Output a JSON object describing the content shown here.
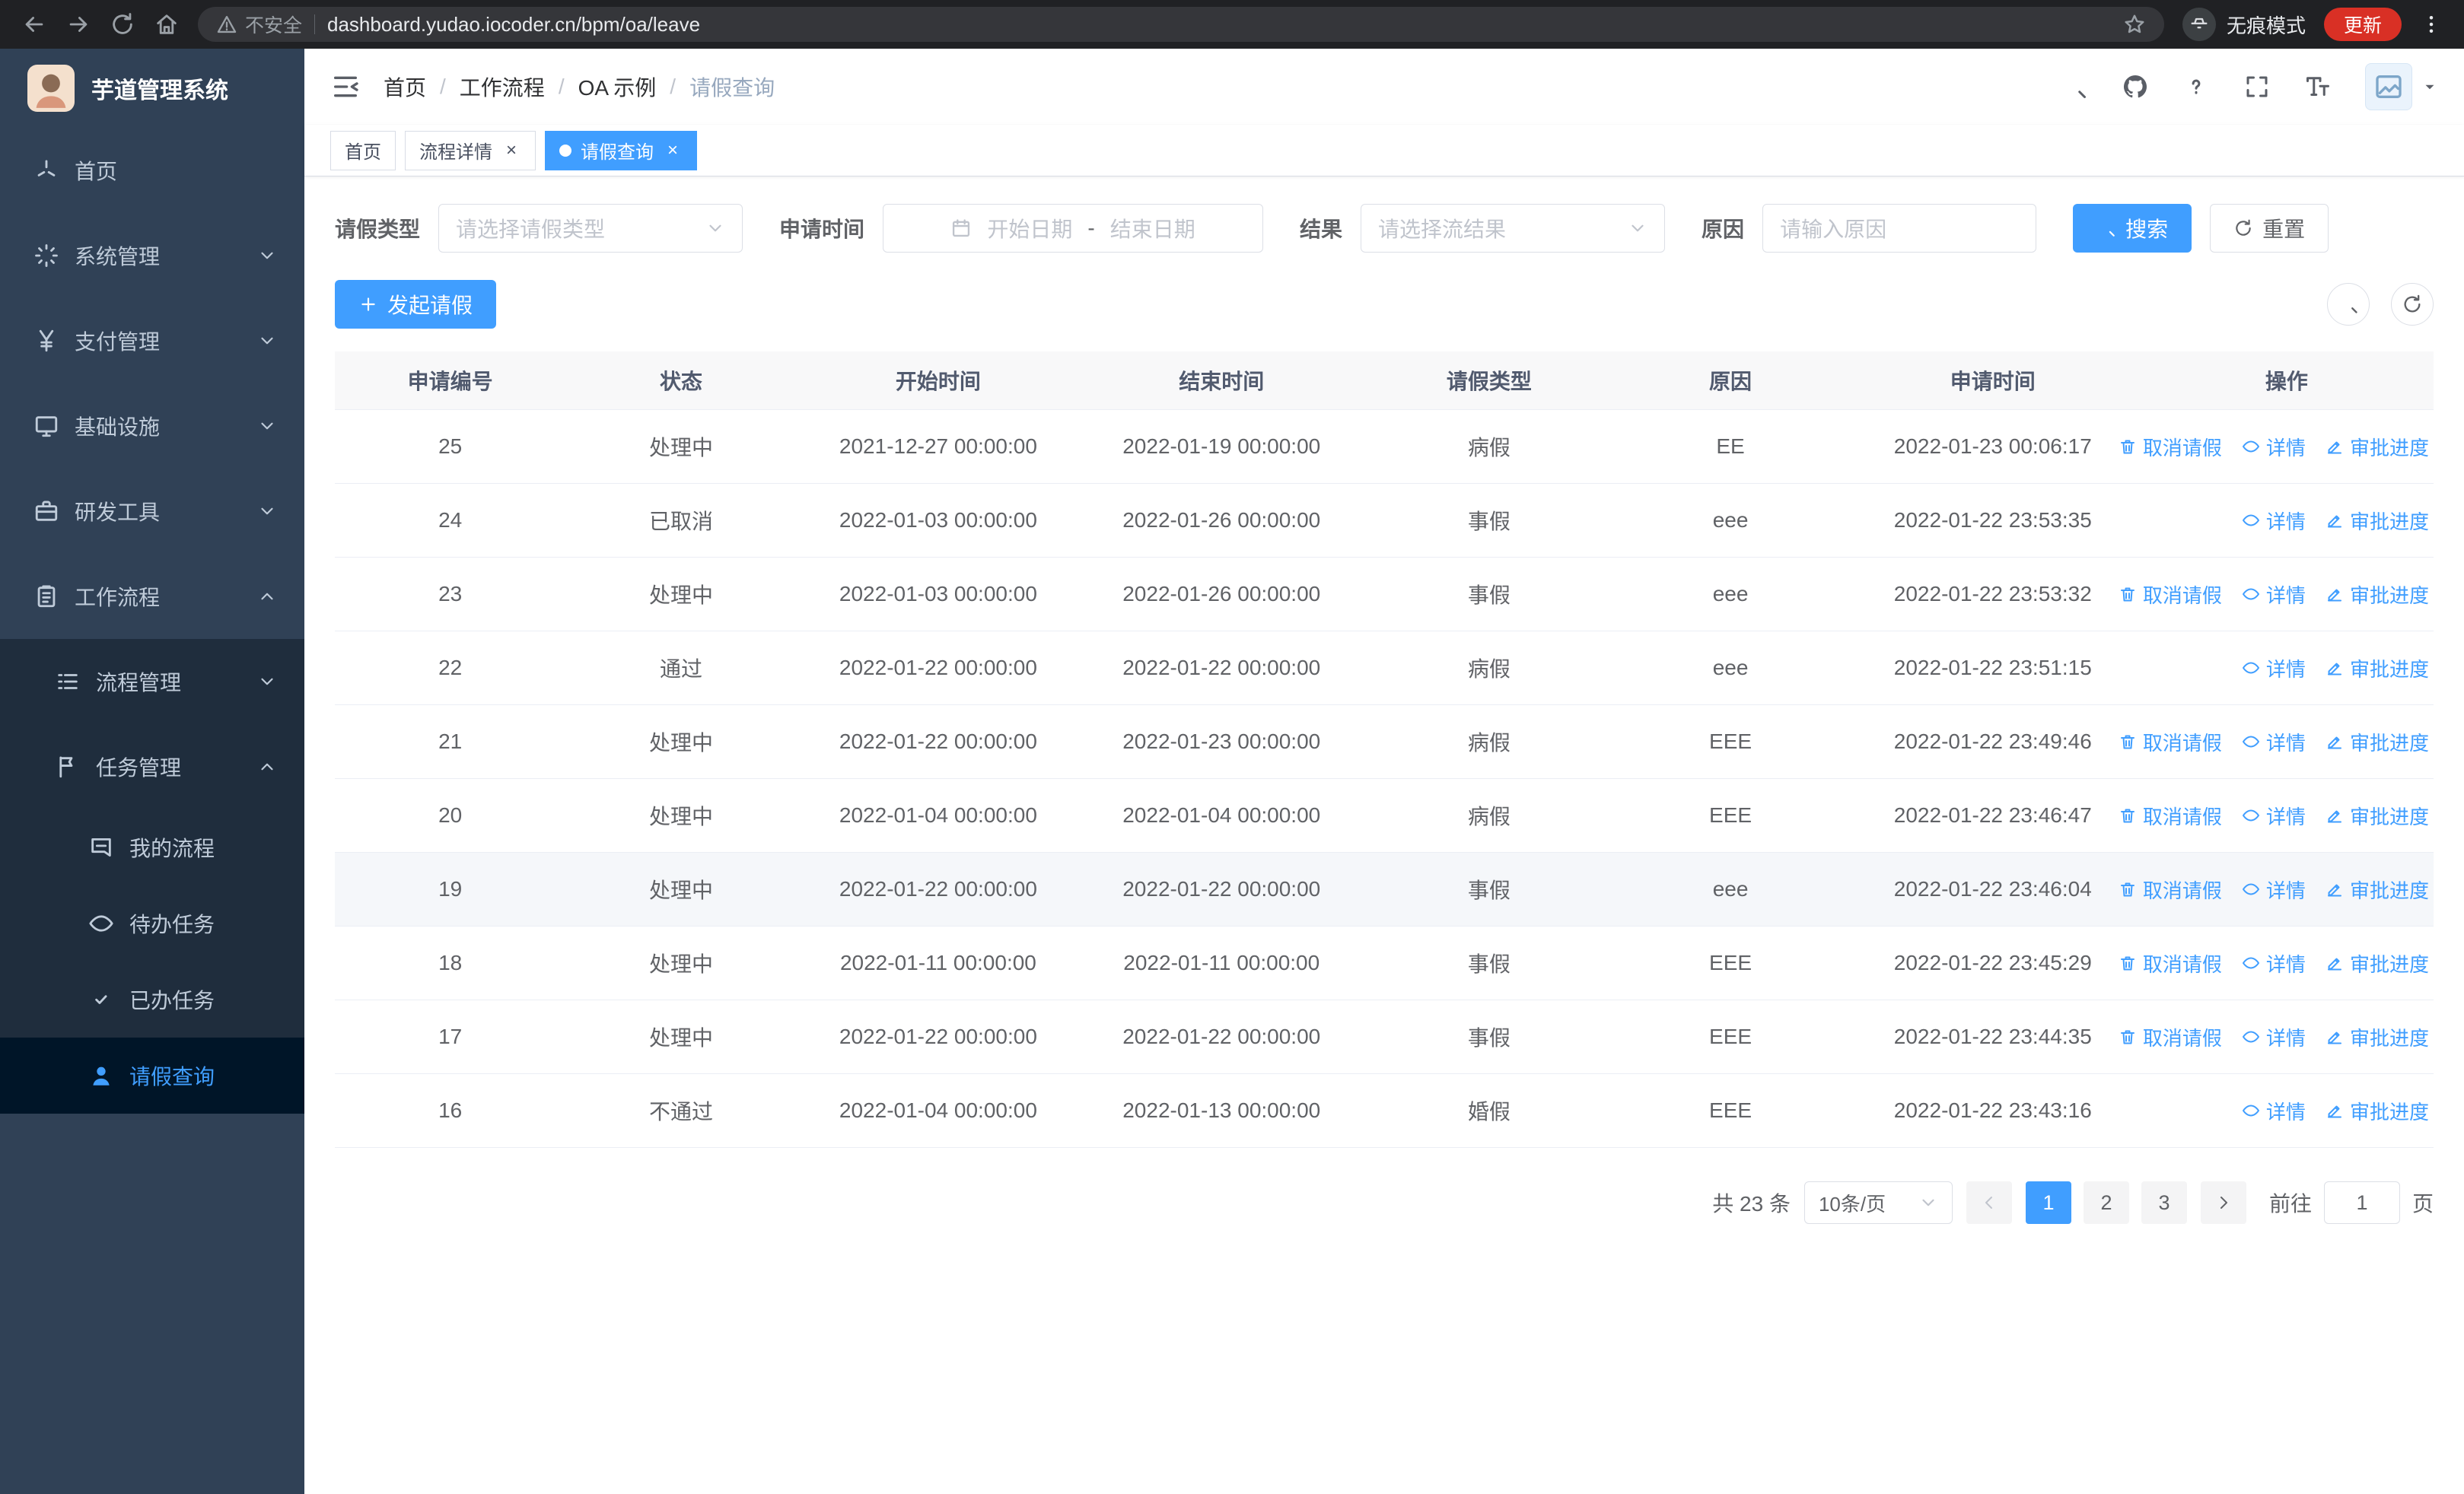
{
  "browser": {
    "security_label": "不安全",
    "url": "dashboard.yudao.iocoder.cn/bpm/oa/leave",
    "incognito_label": "无痕模式",
    "update_label": "更新"
  },
  "sidebar": {
    "logo_title": "芋道管理系统",
    "items": [
      {
        "key": "home",
        "label": "首页",
        "icon": "dashboard",
        "level": 1
      },
      {
        "key": "system",
        "label": "系统管理",
        "icon": "gear",
        "level": 1,
        "arrow": "down"
      },
      {
        "key": "payment",
        "label": "支付管理",
        "icon": "yen",
        "level": 1,
        "arrow": "down"
      },
      {
        "key": "infrastructure",
        "label": "基础设施",
        "icon": "monitor",
        "level": 1,
        "arrow": "down"
      },
      {
        "key": "devtools",
        "label": "研发工具",
        "icon": "briefcase",
        "level": 1,
        "arrow": "down"
      },
      {
        "key": "workflow",
        "label": "工作流程",
        "icon": "clipboard",
        "level": 1,
        "arrow": "up"
      },
      {
        "key": "process-mgmt",
        "label": "流程管理",
        "icon": "list",
        "level": 2,
        "arrow": "down"
      },
      {
        "key": "task-mgmt",
        "label": "任务管理",
        "icon": "flag",
        "level": 2,
        "arrow": "up"
      },
      {
        "key": "my-process",
        "label": "我的流程",
        "icon": "chat",
        "level": 3
      },
      {
        "key": "todo-task",
        "label": "待办任务",
        "icon": "eye",
        "level": 3
      },
      {
        "key": "done-task",
        "label": "已办任务",
        "icon": "check",
        "level": 3
      },
      {
        "key": "leave-query",
        "label": "请假查询",
        "icon": "user",
        "level": 3,
        "active": true
      }
    ]
  },
  "header": {
    "breadcrumb": [
      "首页",
      "工作流程",
      "OA 示例",
      "请假查询"
    ]
  },
  "tabs": [
    {
      "key": "home",
      "label": "首页",
      "closable": false,
      "active": false
    },
    {
      "key": "process-detail",
      "label": "流程详情",
      "closable": true,
      "active": false
    },
    {
      "key": "leave-query",
      "label": "请假查询",
      "closable": true,
      "active": true
    }
  ],
  "filters": {
    "leave_type": {
      "label": "请假类型",
      "placeholder": "请选择请假类型"
    },
    "apply_time": {
      "label": "申请时间",
      "start_placeholder": "开始日期",
      "separator": "-",
      "end_placeholder": "结束日期"
    },
    "result": {
      "label": "结果",
      "placeholder": "请选择流结果"
    },
    "reason": {
      "label": "原因",
      "placeholder": "请输入原因"
    },
    "search_label": "搜索",
    "reset_label": "重置"
  },
  "toolbar": {
    "create_label": "发起请假"
  },
  "table": {
    "columns": [
      "申请编号",
      "状态",
      "开始时间",
      "结束时间",
      "请假类型",
      "原因",
      "申请时间",
      "操作"
    ],
    "op_labels": {
      "cancel": "取消请假",
      "detail": "详情",
      "progress": "审批进度"
    },
    "rows": [
      {
        "id": "25",
        "status": "处理中",
        "start": "2021-12-27 00:00:00",
        "end": "2022-01-19 00:00:00",
        "type": "病假",
        "reason": "EE",
        "applied": "2022-01-23 00:06:17",
        "ops": [
          "cancel",
          "detail",
          "progress"
        ]
      },
      {
        "id": "24",
        "status": "已取消",
        "start": "2022-01-03 00:00:00",
        "end": "2022-01-26 00:00:00",
        "type": "事假",
        "reason": "eee",
        "applied": "2022-01-22 23:53:35",
        "ops": [
          "detail",
          "progress"
        ]
      },
      {
        "id": "23",
        "status": "处理中",
        "start": "2022-01-03 00:00:00",
        "end": "2022-01-26 00:00:00",
        "type": "事假",
        "reason": "eee",
        "applied": "2022-01-22 23:53:32",
        "ops": [
          "cancel",
          "detail",
          "progress"
        ]
      },
      {
        "id": "22",
        "status": "通过",
        "start": "2022-01-22 00:00:00",
        "end": "2022-01-22 00:00:00",
        "type": "病假",
        "reason": "eee",
        "applied": "2022-01-22 23:51:15",
        "ops": [
          "detail",
          "progress"
        ]
      },
      {
        "id": "21",
        "status": "处理中",
        "start": "2022-01-22 00:00:00",
        "end": "2022-01-23 00:00:00",
        "type": "病假",
        "reason": "EEE",
        "applied": "2022-01-22 23:49:46",
        "ops": [
          "cancel",
          "detail",
          "progress"
        ]
      },
      {
        "id": "20",
        "status": "处理中",
        "start": "2022-01-04 00:00:00",
        "end": "2022-01-04 00:00:00",
        "type": "病假",
        "reason": "EEE",
        "applied": "2022-01-22 23:46:47",
        "ops": [
          "cancel",
          "detail",
          "progress"
        ]
      },
      {
        "id": "19",
        "status": "处理中",
        "start": "2022-01-22 00:00:00",
        "end": "2022-01-22 00:00:00",
        "type": "事假",
        "reason": "eee",
        "applied": "2022-01-22 23:46:04",
        "ops": [
          "cancel",
          "detail",
          "progress"
        ],
        "highlighted": true
      },
      {
        "id": "18",
        "status": "处理中",
        "start": "2022-01-11 00:00:00",
        "end": "2022-01-11 00:00:00",
        "type": "事假",
        "reason": "EEE",
        "applied": "2022-01-22 23:45:29",
        "ops": [
          "cancel",
          "detail",
          "progress"
        ]
      },
      {
        "id": "17",
        "status": "处理中",
        "start": "2022-01-22 00:00:00",
        "end": "2022-01-22 00:00:00",
        "type": "事假",
        "reason": "EEE",
        "applied": "2022-01-22 23:44:35",
        "ops": [
          "cancel",
          "detail",
          "progress"
        ]
      },
      {
        "id": "16",
        "status": "不通过",
        "start": "2022-01-04 00:00:00",
        "end": "2022-01-13 00:00:00",
        "type": "婚假",
        "reason": "EEE",
        "applied": "2022-01-22 23:43:16",
        "ops": [
          "detail",
          "progress"
        ]
      }
    ]
  },
  "pagination": {
    "total_label": "共 23 条",
    "page_size": "10条/页",
    "pages": [
      "1",
      "2",
      "3"
    ],
    "active_page": "1",
    "goto_label": "前往",
    "goto_value": "1",
    "goto_suffix": "页"
  },
  "colors": {
    "primary": "#409eff",
    "sidebar_bg": "#304156",
    "submenu_bg": "#1f2d3d"
  }
}
